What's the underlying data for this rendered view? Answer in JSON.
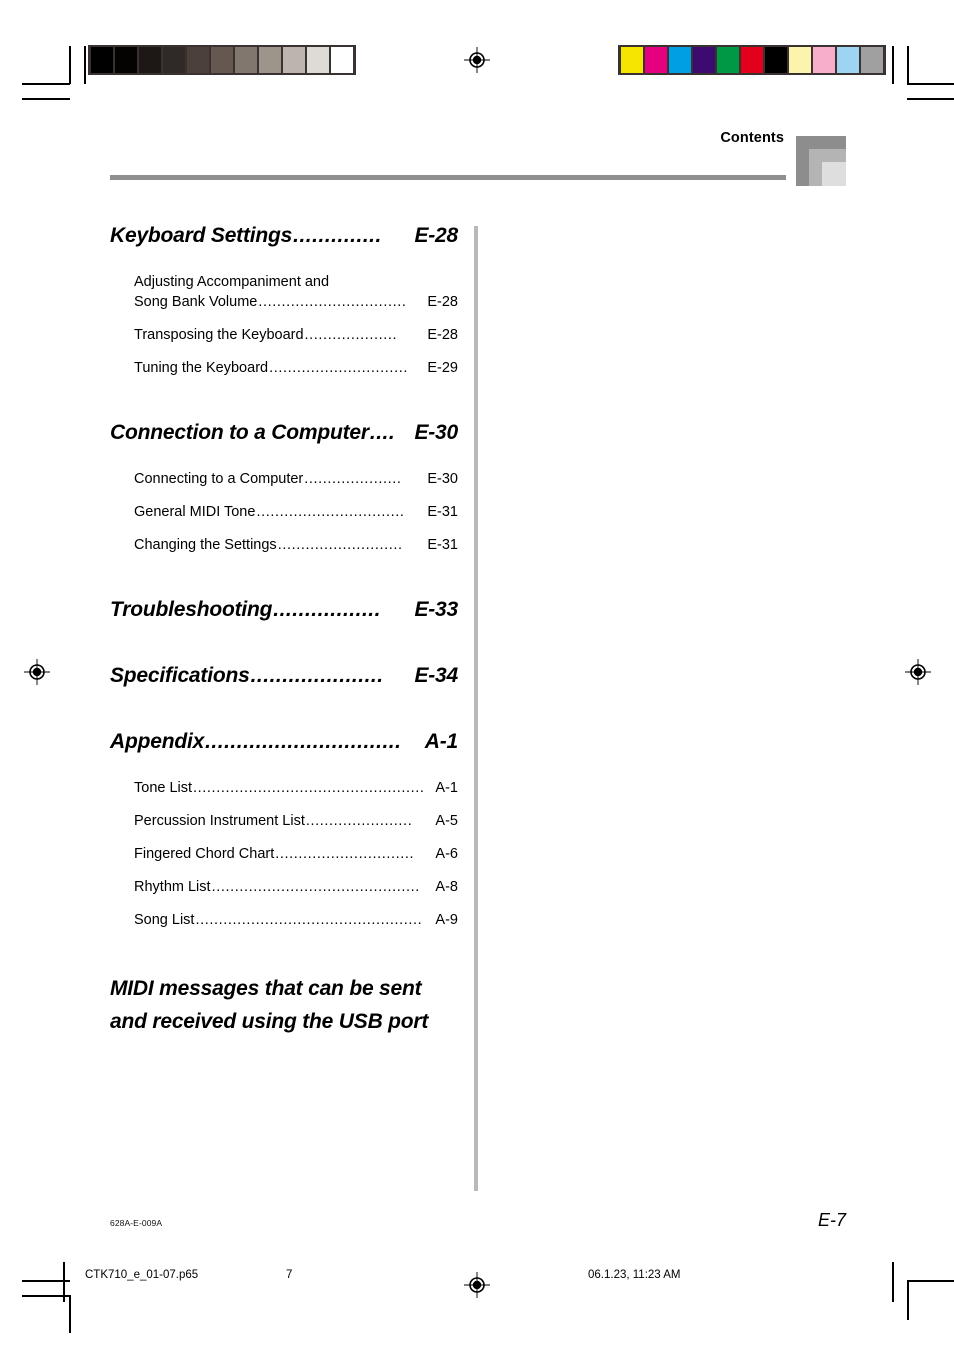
{
  "header": {
    "title": "Contents",
    "logo_icon": "nested-squares-logo"
  },
  "calibration": {
    "gray_bar_icon": "grayscale-calibration-bar",
    "color_bar_icon": "color-calibration-bar",
    "grayscale_swatches": [
      "#000000",
      "#050202",
      "#1d1715",
      "#312925",
      "#4b403a",
      "#645850",
      "#82776f",
      "#9d948c",
      "#bdb4ad",
      "#dedad4",
      "#ffffff"
    ],
    "color_swatches": [
      "#f5e500",
      "#e4007f",
      "#009fe3",
      "#3d0a70",
      "#009844",
      "#e2001a",
      "#000000",
      "#fcf3ad",
      "#f6aecb",
      "#9dd4f3",
      "#a0a0a0"
    ]
  },
  "toc": {
    "sections": [
      {
        "label": "Keyboard Settings",
        "leader": "..............",
        "page": "E-28",
        "items": [
          {
            "label": "Adjusting Accompaniment and",
            "label_line2": "Song Bank Volume",
            "leader": "................................",
            "page": "E-28",
            "wrapped": true
          },
          {
            "label": "Transposing the Keyboard",
            "leader": "....................",
            "page": "E-28",
            "wrapped": false
          },
          {
            "label": "Tuning the Keyboard",
            "leader": "..............................",
            "page": "E-29",
            "wrapped": false
          }
        ]
      },
      {
        "label": "Connection to a Computer",
        "leader": "....",
        "page": "E-30",
        "items": [
          {
            "label": "Connecting to a Computer",
            "leader": ".....................",
            "page": "E-30",
            "wrapped": false
          },
          {
            "label": "General MIDI Tone",
            "leader": "................................",
            "page": "E-31",
            "wrapped": false
          },
          {
            "label": "Changing the Settings",
            "leader": "...........................",
            "page": "E-31",
            "wrapped": false
          }
        ]
      },
      {
        "label": "Troubleshooting",
        "leader": ".................",
        "page": "E-33",
        "items": []
      },
      {
        "label": "Specifications",
        "leader": ".....................",
        "page": "E-34",
        "items": []
      },
      {
        "label": "Appendix",
        "leader": "...............................",
        "page": "A-1",
        "items": [
          {
            "label": "Tone List",
            "leader": "..................................................",
            "page": "A-1",
            "wrapped": false
          },
          {
            "label": "Percussion Instrument List",
            "leader": ".......................",
            "page": "A-5",
            "wrapped": false
          },
          {
            "label": "Fingered Chord Chart",
            "leader": "..............................",
            "page": "A-6",
            "wrapped": false
          },
          {
            "label": "Rhythm List",
            "leader": ".............................................",
            "page": "A-8",
            "wrapped": false
          },
          {
            "label": "Song List",
            "leader": ".................................................",
            "page": "A-9",
            "wrapped": false
          }
        ]
      }
    ],
    "final_heading_line1": "MIDI messages that can be sent",
    "final_heading_line2": "and received using the USB port"
  },
  "footer": {
    "document_code": "628A-E-009A",
    "page_label": "E-7"
  },
  "print_strip": {
    "file_name": "CTK710_e_01-07.p65",
    "page_number": "7",
    "timestamp": "06.1.23, 11:23 AM"
  }
}
